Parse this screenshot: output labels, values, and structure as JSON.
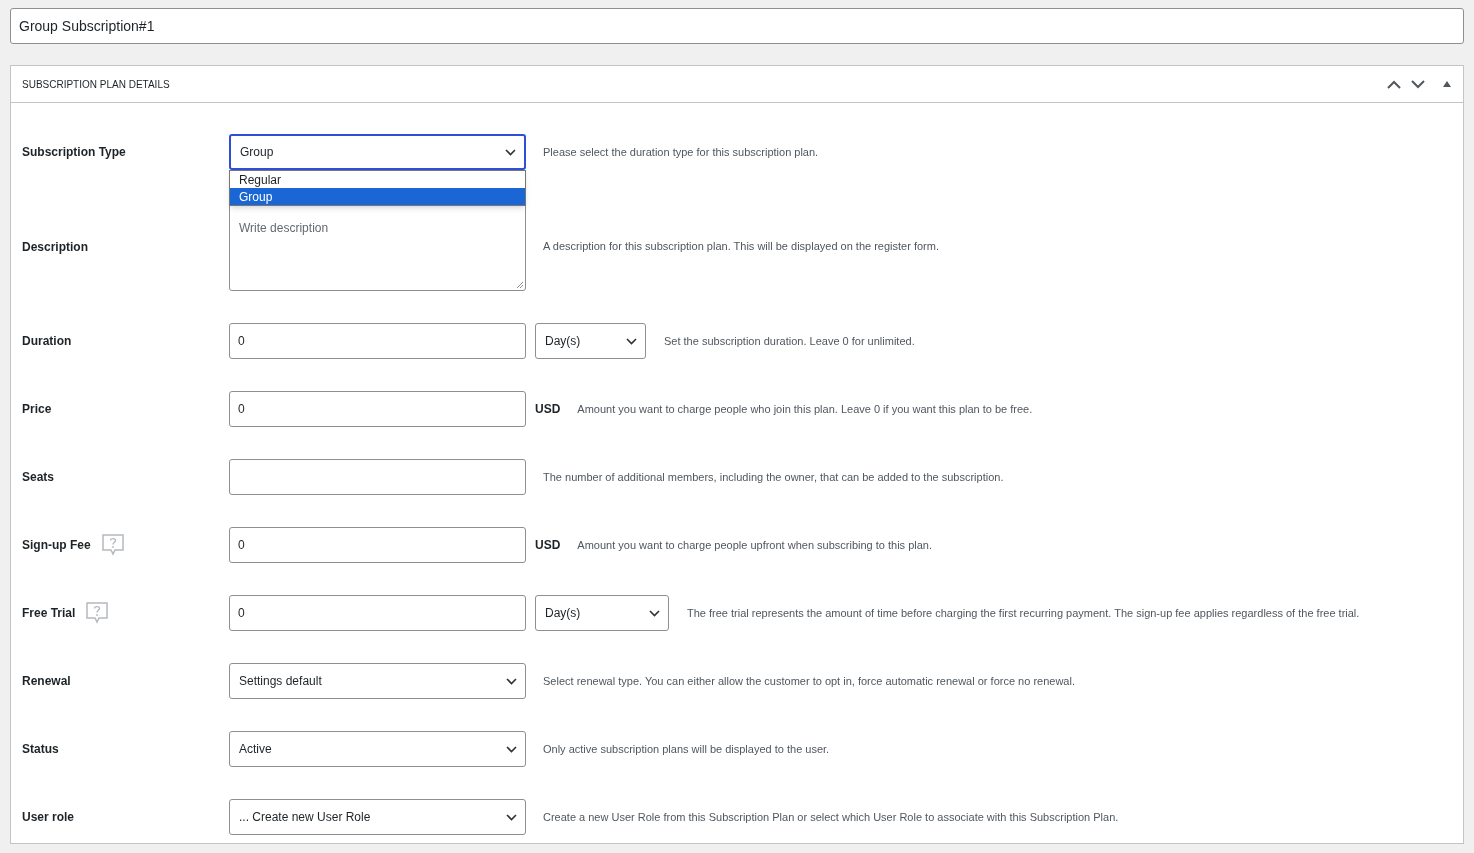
{
  "title_field": {
    "value": "Group Subscription#1"
  },
  "panel": {
    "title": "SUBSCRIPTION PLAN DETAILS"
  },
  "fields": [
    {
      "kind": "select",
      "label": "Subscription Type",
      "help_icon": false,
      "value": "Group",
      "focused": true,
      "open": true,
      "options": [
        {
          "label": "Regular",
          "selected": false
        },
        {
          "label": "Group",
          "selected": true
        }
      ],
      "help": "Please select the duration type for this subscription plan."
    },
    {
      "kind": "textarea",
      "label": "Description",
      "help_icon": false,
      "placeholder": "Write description",
      "help": "A description for this subscription plan. This will be displayed on the register form."
    },
    {
      "kind": "text_unit",
      "label": "Duration",
      "help_icon": false,
      "value": "0",
      "unit": "Day(s)",
      "help": "Set the subscription duration. Leave 0 for unlimited."
    },
    {
      "kind": "text_currency",
      "label": "Price",
      "help_icon": false,
      "value": "0",
      "currency": "USD",
      "help": "Amount you want to charge people who join this plan. Leave 0 if you want this plan to be free."
    },
    {
      "kind": "text",
      "label": "Seats",
      "help_icon": false,
      "help": "The number of additional members, including the owner, that can be added to the subscription."
    },
    {
      "kind": "text_currency",
      "label": "Sign-up Fee",
      "help_icon": true,
      "value": "0",
      "currency": "USD",
      "help": "Amount you want to charge people upfront when subscribing to this plan."
    },
    {
      "kind": "text_unit",
      "label": "Free Trial",
      "help_icon": true,
      "value": "0",
      "unit": "Day(s)",
      "help": "The free trial represents the amount of time before charging the first recurring payment. The sign-up fee applies regardless of the free trial."
    },
    {
      "kind": "select",
      "label": "Renewal",
      "help_icon": false,
      "value": "Settings default",
      "focused": false,
      "help": "Select renewal type. You can either allow the customer to opt in, force automatic renewal or force no renewal."
    },
    {
      "kind": "select",
      "label": "Status",
      "help_icon": false,
      "value": "Active",
      "focused": false,
      "help": "Only active subscription plans will be displayed to the user."
    },
    {
      "kind": "select",
      "label": "User role",
      "help_icon": false,
      "value": "... Create new User Role",
      "focused": false,
      "help": "Create a new User Role from this Subscription Plan or select which User Role to associate with this Subscription Plan."
    }
  ]
}
